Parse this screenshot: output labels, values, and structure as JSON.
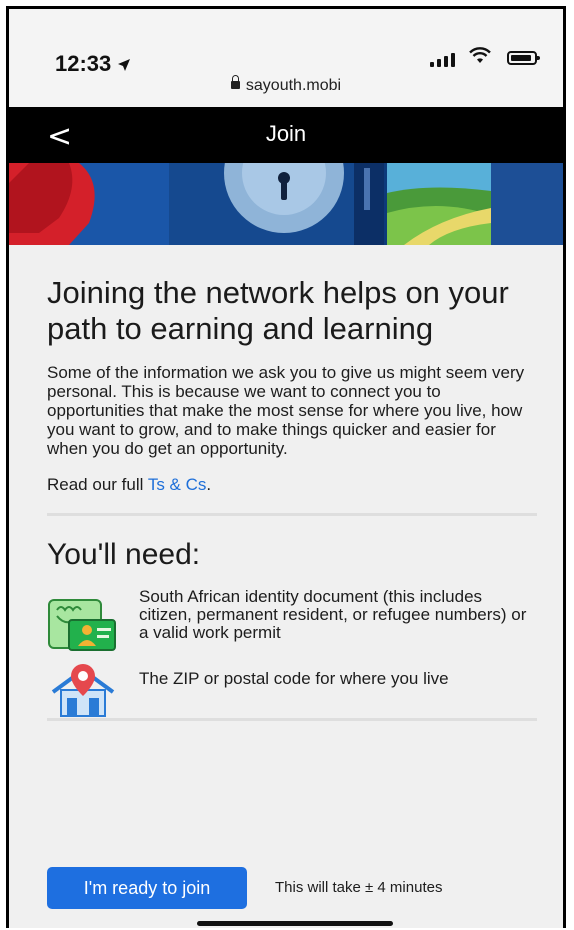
{
  "status_bar": {
    "time": "12:33",
    "url": "sayouth.mobi"
  },
  "nav": {
    "back_glyph": "<",
    "title": "Join"
  },
  "content": {
    "headline": "Joining the network helps on your path to earning and learning",
    "intro": "Some of the information we ask you to give us might seem very personal. This is because we want to connect you to opportunities that make the most sense for where you live, how you want to grow, and to make things quicker and easier for when you do get an opportunity.",
    "read_prefix": "Read our full ",
    "terms_link": "Ts & Cs",
    "read_suffix": "."
  },
  "needs": {
    "title": "You'll need:",
    "items": [
      {
        "icon": "id-card-icon",
        "text": "South African identity document (this includes citizen, permanent resident, or refugee numbers) or a valid work permit"
      },
      {
        "icon": "house-location-icon",
        "text": "The ZIP or postal code for where you live"
      }
    ]
  },
  "footer": {
    "cta_label": "I'm ready to join",
    "duration_text": "This will take ± 4 minutes"
  },
  "colors": {
    "accent": "#1e6fe0",
    "link": "#1e6fd9",
    "navbar": "#000000",
    "background": "#f0f0f0"
  }
}
